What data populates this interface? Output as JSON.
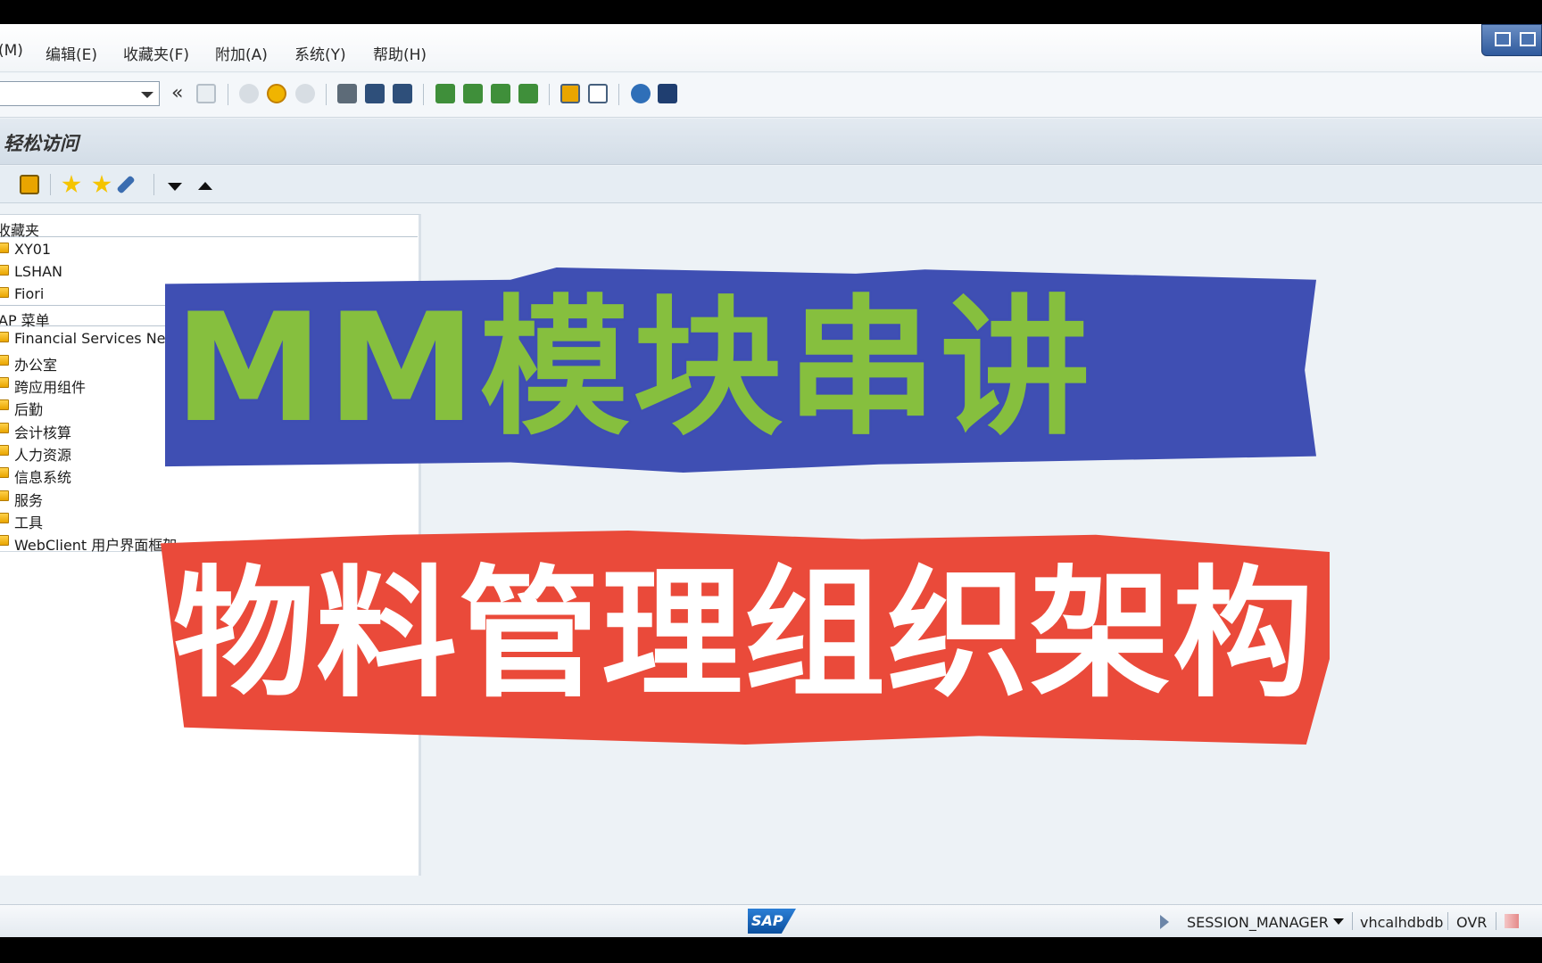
{
  "menubar": {
    "items": [
      "(M)",
      "编辑(E)",
      "收藏夹(F)",
      "附加(A)",
      "系统(Y)",
      "帮助(H)"
    ]
  },
  "toolbar": {
    "command_value": "",
    "back_glyph": "«",
    "icons": [
      "save-icon",
      "back-icon",
      "exit-icon",
      "cancel-icon",
      "print-icon",
      "find-icon",
      "find-next-icon",
      "first-page-icon",
      "previous-page-icon",
      "next-page-icon",
      "last-page-icon",
      "create-session-icon",
      "create-shortcut-icon",
      "help-icon",
      "customize-layout-icon"
    ]
  },
  "title": "轻松访问",
  "apptoolbar": {
    "icons": [
      "other-menu-icon",
      "add-favorite-icon",
      "change-favorite-icon",
      "edit-icon",
      "expand-down-icon",
      "collapse-up-icon"
    ]
  },
  "tree": {
    "favorites_header": "收藏夹",
    "favorites": [
      "XY01",
      "LSHAN",
      "Fiori"
    ],
    "sap_menu_header": "AP 菜单",
    "sap_menu": [
      "Financial Services Netw",
      "办公室",
      "跨应用组件",
      "后勤",
      "会计核算",
      "人力资源",
      "信息系统",
      "服务",
      "工具",
      "WebClient 用户界面框架"
    ]
  },
  "banner": {
    "line1": "MM模块串讲",
    "line2": "物料管理组织架构"
  },
  "statusbar": {
    "logo": "SAP",
    "session": "SESSION_MANAGER",
    "host": "vhcalhdbdb",
    "mode": "OVR"
  },
  "colors": {
    "banner_line1_fill": "#86bf3e",
    "banner_line1_outline": "#3f4fb3",
    "banner_line2_fill": "#ffffff",
    "banner_line2_outline": "#ea4a3a",
    "window_background": "#edf2f6"
  }
}
